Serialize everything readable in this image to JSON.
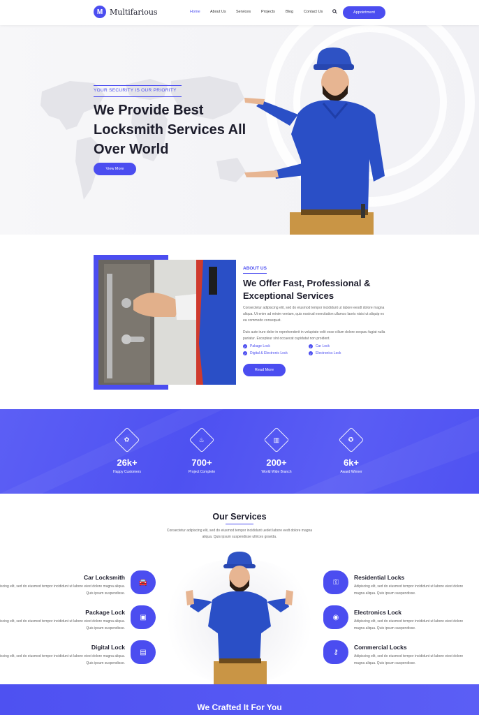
{
  "nav": {
    "logo_letter": "M",
    "brand": "Multifarious",
    "items": [
      "Home",
      "About Us",
      "Services",
      "Projects",
      "Blog",
      "Contact Us"
    ],
    "cta": "Appointment"
  },
  "hero": {
    "eyebrow": "YOUR SECURITY IS OUR PRIORITY",
    "title": "We Provide Best Locksmith Services All Over World",
    "button": "View More"
  },
  "about": {
    "eyebrow": "ABOUT US",
    "title": "We Offer Fast, Professional & Exceptional Services",
    "p1": "Consectetur adipiscing elit, sed do eiusmod tempor incididunt ut labore eesdt dolore magna aliqua. Ut enim ad minim veniam, quis nostrud exercitation ullamco laoris nisisi ut aliquip ex ea commodo consequat.",
    "p2": "Duis aute irure dolor in reprehenderit in voluptate velit esse cillum dolore eeqasu fugiat nulla pariatur. Excepteur sint occaecat cupidatat non proident.",
    "checks": [
      "Pakage Lock",
      "Car Lock",
      "Digital & Electronic Lock",
      "Electronics Lock"
    ],
    "button": "Read More"
  },
  "stats": [
    {
      "icon": "gear-icon",
      "glyph": "✿",
      "value": "26k+",
      "label": "Happy Customers"
    },
    {
      "icon": "rocket-icon",
      "glyph": "♨",
      "value": "700+",
      "label": "Project Complete"
    },
    {
      "icon": "building-icon",
      "glyph": "▥",
      "value": "200+",
      "label": "World Wide Branch"
    },
    {
      "icon": "award-icon",
      "glyph": "✪",
      "value": "6k+",
      "label": "Award Winner"
    }
  ],
  "services": {
    "title": "Our Services",
    "subtitle": "Consectetur adipiscing elit, sed do eiusmod tempor incididunt uedet labore eedt dolore magna aliqua. Quis ipsum suspendisse ultrices gravida.",
    "items": [
      {
        "title": "Car Locksmith",
        "text": "Adipiscing elit, sed do eiusmod tempor incididunt ut labore eiest dolore magna aliqua. Quis ipsum suspendisse.",
        "icon": "car-icon",
        "glyph": "🚘"
      },
      {
        "title": "Package Lock",
        "text": "Adipiscing elit, sed do eiusmod tempor incididunt ut labore eiest dolore magna aliqua. Quis ipsum suspendisse.",
        "icon": "package-icon",
        "glyph": "▣"
      },
      {
        "title": "Digital Lock",
        "text": "Adipiscing elit, sed do eiusmod tempor incididunt ut labore eiest dolore magna aliqua. Quis ipsum suspendisse.",
        "icon": "digital-lock-icon",
        "glyph": "▤"
      },
      {
        "title": "Residential Locks",
        "text": "Adipiscing elit, sed do eiusmod tempor incididunt ut labore eiest dolore magna aliqua. Quis ipsum suspendisse.",
        "icon": "door-lock-icon",
        "glyph": "⚿"
      },
      {
        "title": "Electronics Lock",
        "text": "Adipiscing elit, sed do eiusmod tempor incididunt ut labore eiest dolore magna aliqua. Quis ipsum suspendisse.",
        "icon": "electronics-icon",
        "glyph": "◉"
      },
      {
        "title": "Commercial Locks",
        "text": "Adipiscing elit, sed do eiusmod tempor incididunt ut labore eiest dolore magna aliqua. Quis ipsum suspendisse.",
        "icon": "key-icon",
        "glyph": "⚷"
      }
    ]
  },
  "crafted": {
    "title": "We Crafted It For You"
  },
  "colors": {
    "accent": "#4b4df0",
    "dark": "#1c1c2b"
  }
}
